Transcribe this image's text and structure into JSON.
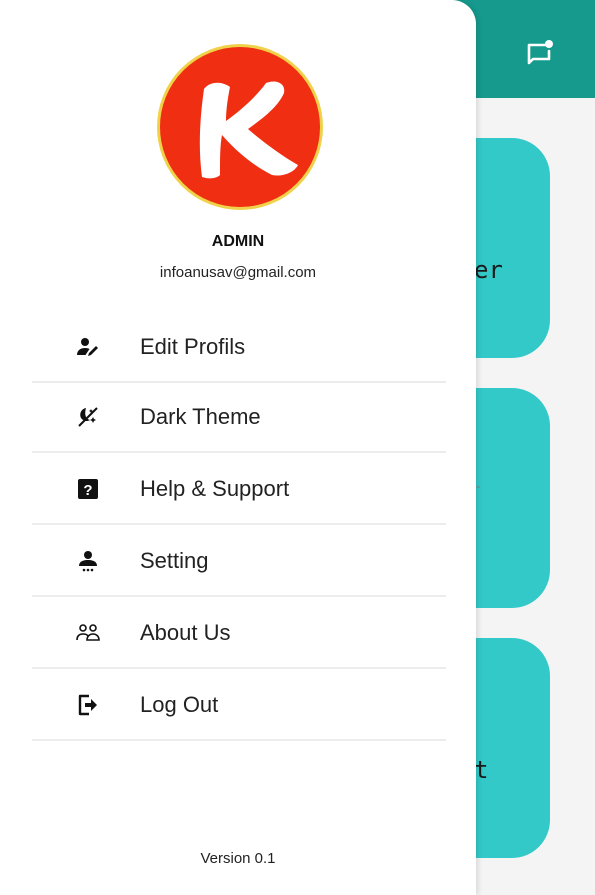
{
  "background": {
    "card1_text": "er",
    "card3_text": "t"
  },
  "drawer": {
    "admin_name": "ADMIN",
    "admin_email": "infoanusav@gmail.com",
    "menu": [
      {
        "label": "Edit Profils",
        "icon": "edit-profile-icon"
      },
      {
        "label": "Dark Theme",
        "icon": "dark-theme-icon"
      },
      {
        "label": "Help & Support",
        "icon": "help-icon"
      },
      {
        "label": "Setting",
        "icon": "setting-icon"
      },
      {
        "label": "About Us",
        "icon": "about-us-icon"
      },
      {
        "label": "Log Out",
        "icon": "logout-icon"
      }
    ],
    "version": "Version 0.1"
  },
  "colors": {
    "topbar": "#159a8d",
    "card": "#34c9c9",
    "avatar_bg": "#ef2e12",
    "avatar_border": "#f0d24a"
  }
}
